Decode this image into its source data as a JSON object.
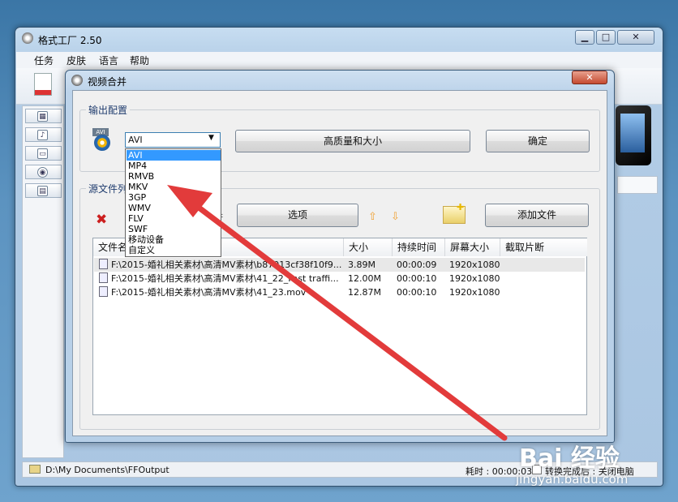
{
  "main_window": {
    "title": "格式工厂 2.50",
    "menu": [
      "任务",
      "皮肤",
      "语言",
      "帮助"
    ],
    "status_path": "D:\\My Documents\\FFOutput",
    "elapsed_label": "耗时 : 00:00:03",
    "after_convert_label": "转换完成后 : 关闭电脑"
  },
  "dialog": {
    "title": "视频合并",
    "output_group_label": "输出配置",
    "source_group_label": "源文件列表",
    "format_badge": "AVI",
    "combo_value": "AVI",
    "format_options": [
      "AVI",
      "MP4",
      "RMVB",
      "MKV",
      "3GP",
      "WMV",
      "FLV",
      "SWF",
      "移动设备",
      "自定义"
    ],
    "selected_option": "AVI",
    "quality_button": "高质量和大小",
    "ok_button": "确定",
    "options_button": "选项",
    "add_file_button": "添加文件",
    "columns": [
      "文件名",
      "大小",
      "持续时间",
      "屏幕大小",
      "截取片断"
    ],
    "files": [
      {
        "name": "F:\\2015-婚礼相关素材\\高清MV素材\\b87013cf38f10f9...",
        "size": "3.89M",
        "duration": "00:00:09",
        "screen": "1920x1080",
        "clip": ""
      },
      {
        "name": "F:\\2015-婚礼相关素材\\高清MV素材\\41_22_Fast traffi...",
        "size": "12.00M",
        "duration": "00:00:10",
        "screen": "1920x1080",
        "clip": ""
      },
      {
        "name": "F:\\2015-婚礼相关素材\\高清MV素材\\41_23.mov",
        "size": "12.87M",
        "duration": "00:00:10",
        "screen": "1920x1080",
        "clip": ""
      }
    ]
  },
  "watermark": {
    "line1": "Bai 经验",
    "line2": "jingyan.baidu.com"
  },
  "colors": {
    "annotation_arrow": "#e23b3b",
    "selection": "#3399ff",
    "delete_icon": "#cc1f1f"
  }
}
